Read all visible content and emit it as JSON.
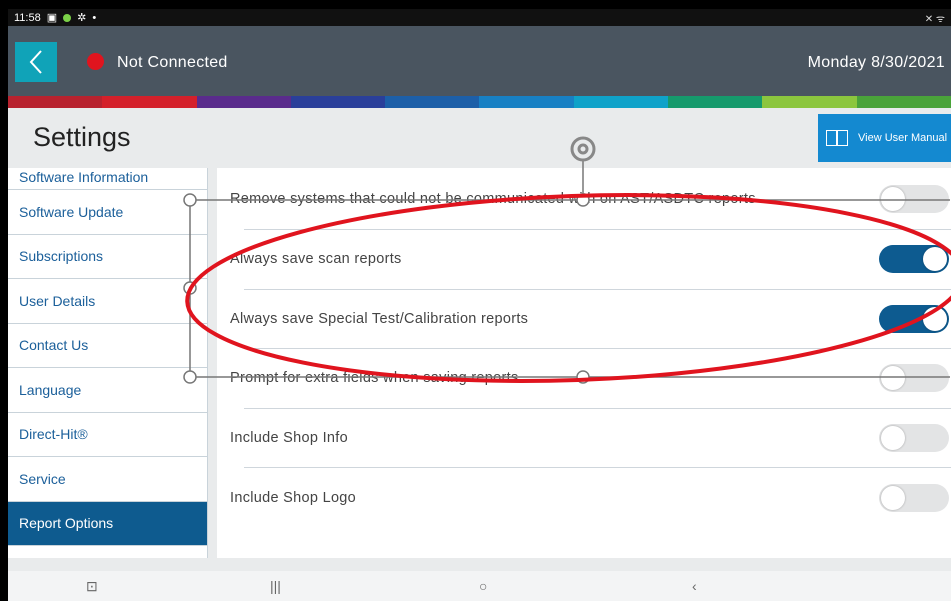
{
  "status": {
    "time": "11:58",
    "right": "✕ ᯤ"
  },
  "header": {
    "connection": "Not Connected",
    "date": "Monday 8/30/2021"
  },
  "page": {
    "title": "Settings",
    "manual_button": "View User Manual"
  },
  "sidebar": {
    "items": [
      {
        "label": "Software Information"
      },
      {
        "label": "Software Update"
      },
      {
        "label": "Subscriptions"
      },
      {
        "label": "User Details"
      },
      {
        "label": "Contact Us"
      },
      {
        "label": "Language"
      },
      {
        "label": "Direct-Hit®"
      },
      {
        "label": "Service"
      },
      {
        "label": "Report Options"
      }
    ]
  },
  "settings": {
    "rows": [
      {
        "label": "Remove systems that could not be communicated with on AST/ASDTC reports",
        "on": false
      },
      {
        "label": "Always save scan reports",
        "on": true
      },
      {
        "label": "Always save Special Test/Calibration reports",
        "on": true
      },
      {
        "label": "Prompt for extra fields when saving reports",
        "on": false
      },
      {
        "label": "Include Shop Info",
        "on": false
      },
      {
        "label": "Include Shop Logo",
        "on": false
      }
    ]
  },
  "colors": {
    "accent": "#0e5b8f",
    "back_button": "#10a3b8",
    "manual_button": "#1489d0",
    "annotation": "#e0141e",
    "status_dot": "#e0141e"
  },
  "rainbow": [
    "#b8222e",
    "#d4202a",
    "#5a2b8c",
    "#2a3f9a",
    "#1d5fa8",
    "#1880c4",
    "#0fa2c9",
    "#169a6c",
    "#8cc63e",
    "#4aa33a"
  ]
}
